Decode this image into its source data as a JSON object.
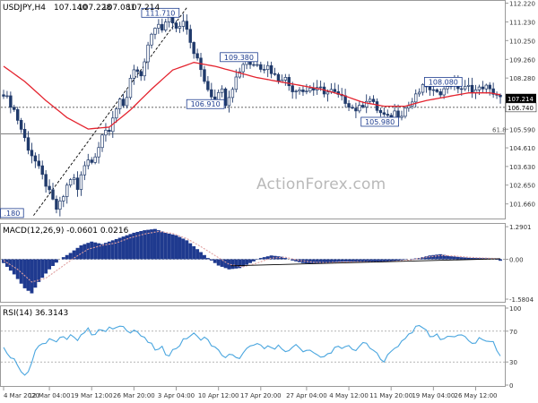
{
  "chart_data": [
    {
      "type": "candlestick",
      "title": "USDJPY,H4",
      "header_values": [
        "107.140",
        "107.228",
        "107.081",
        "107.214"
      ],
      "ylim": [
        100.94,
        112.29
      ],
      "y_ticks": [
        "112.220",
        "111.230",
        "110.250",
        "109.260",
        "108.280",
        "107.214",
        "106.740",
        "105.590",
        "104.610",
        "103.630",
        "102.650",
        "101.660"
      ],
      "current_price": 107.214,
      "current_price_label": "107.214",
      "support_level": 106.74,
      "support_level_label": "106.740",
      "fib_level": 105.35,
      "fib_label": "61.8",
      "close_path": [
        [
          0,
          107.5
        ],
        [
          3,
          106.6
        ],
        [
          5,
          105.6
        ],
        [
          7,
          104.6
        ],
        [
          9,
          103.9
        ],
        [
          10.5,
          103.3
        ],
        [
          12,
          102.7
        ],
        [
          13.5,
          102.0
        ],
        [
          15,
          101.4
        ],
        [
          16.5,
          101.8
        ],
        [
          18,
          102.6
        ],
        [
          19.5,
          103.2
        ],
        [
          21,
          102.4
        ],
        [
          22.5,
          103.5
        ],
        [
          24,
          104.1
        ],
        [
          25.5,
          103.8
        ],
        [
          27,
          104.8
        ],
        [
          28.5,
          105.7
        ],
        [
          30,
          105.3
        ],
        [
          31.5,
          106.5
        ],
        [
          33,
          107.2
        ],
        [
          34.5,
          106.8
        ],
        [
          36,
          108.1
        ],
        [
          37.5,
          108.8
        ],
        [
          39,
          108.3
        ],
        [
          40.5,
          109.5
        ],
        [
          42,
          110.6
        ],
        [
          43.5,
          111.2
        ],
        [
          45,
          110.7
        ],
        [
          46.5,
          111.6
        ],
        [
          48,
          111.3
        ],
        [
          49.5,
          110.9
        ],
        [
          51,
          111.4
        ],
        [
          52.5,
          110.4
        ],
        [
          54,
          109.6
        ],
        [
          55.5,
          109.0
        ],
        [
          57,
          108.2
        ],
        [
          58.5,
          107.5
        ],
        [
          60,
          107.2
        ],
        [
          61.5,
          107.9
        ],
        [
          63,
          107.0
        ],
        [
          64.5,
          107.6
        ],
        [
          66,
          108.3
        ],
        [
          67.5,
          108.9
        ],
        [
          69,
          109.3
        ],
        [
          70.5,
          108.9
        ],
        [
          72,
          109.1
        ],
        [
          73.5,
          108.8
        ],
        [
          75,
          108.9
        ],
        [
          76.5,
          108.5
        ],
        [
          78,
          108.2
        ],
        [
          79.5,
          108.4
        ],
        [
          81,
          107.9
        ],
        [
          82.5,
          107.6
        ],
        [
          84,
          107.8
        ],
        [
          85.5,
          107.5
        ],
        [
          87,
          107.8
        ],
        [
          88.5,
          107.6
        ],
        [
          90,
          107.7
        ],
        [
          91.5,
          107.5
        ],
        [
          93,
          107.6
        ],
        [
          94.5,
          107.4
        ],
        [
          96,
          107.2
        ],
        [
          97.5,
          107.0
        ],
        [
          99,
          106.7
        ],
        [
          100.5,
          106.6
        ],
        [
          102,
          106.9
        ],
        [
          103.5,
          107.3
        ],
        [
          105,
          106.9
        ],
        [
          106.5,
          106.5
        ],
        [
          108,
          106.3
        ],
        [
          109.5,
          106.1
        ],
        [
          111,
          106.5
        ],
        [
          112.5,
          106.3
        ],
        [
          114,
          106.7
        ],
        [
          115.5,
          106.9
        ],
        [
          117,
          107.3
        ],
        [
          118.5,
          107.7
        ],
        [
          120,
          107.9
        ],
        [
          121.5,
          107.4
        ],
        [
          123,
          107.7
        ],
        [
          124.5,
          107.5
        ],
        [
          126,
          107.9
        ],
        [
          127.5,
          108.0
        ],
        [
          129,
          107.8
        ],
        [
          130.5,
          107.7
        ],
        [
          132,
          107.8
        ],
        [
          133.5,
          107.6
        ],
        [
          135,
          107.7
        ],
        [
          136.5,
          107.9
        ],
        [
          138,
          107.6
        ],
        [
          139.5,
          107.5
        ],
        [
          141,
          107.2
        ]
      ],
      "ma_path": [
        [
          0,
          108.9
        ],
        [
          6,
          108.1
        ],
        [
          12,
          107.1
        ],
        [
          18,
          106.2
        ],
        [
          24,
          105.6
        ],
        [
          30,
          105.7
        ],
        [
          36,
          106.6
        ],
        [
          42,
          107.7
        ],
        [
          48,
          108.7
        ],
        [
          54,
          109.1
        ],
        [
          60,
          108.9
        ],
        [
          66,
          108.6
        ],
        [
          72,
          108.3
        ],
        [
          78,
          108.1
        ],
        [
          84,
          107.9
        ],
        [
          90,
          107.7
        ],
        [
          96,
          107.4
        ],
        [
          102,
          107.0
        ],
        [
          108,
          106.8
        ],
        [
          114,
          106.8
        ],
        [
          120,
          107.1
        ],
        [
          126,
          107.3
        ],
        [
          132,
          107.5
        ],
        [
          138,
          107.5
        ],
        [
          141,
          107.4
        ]
      ],
      "trendline": [
        [
          8.5,
          101.05
        ],
        [
          52,
          111.98
        ]
      ],
      "annotations": [
        {
          "text": "111.710",
          "x": 44.5,
          "y": 111.71
        },
        {
          "text": "109.380",
          "x": 66.8,
          "y": 109.38
        },
        {
          "text": "106.910",
          "x": 57.3,
          "y": 106.91
        },
        {
          "text": "108.080",
          "x": 124.8,
          "y": 108.08
        },
        {
          "text": "105.980",
          "x": 106.8,
          "y": 105.98
        },
        {
          "text": ".180",
          "x": 2.4,
          "y": 101.18
        }
      ],
      "x_ticks": [
        {
          "label": "4 Mar 2020",
          "i": 0
        },
        {
          "label": "12 Mar 04:00",
          "i": 13
        },
        {
          "label": "19 Mar 12:00",
          "i": 25
        },
        {
          "label": "26 Mar 20:00",
          "i": 37
        },
        {
          "label": "3 Apr 04:00",
          "i": 49
        },
        {
          "label": "10 Apr 12:00",
          "i": 61
        },
        {
          "label": "17 Apr 20:00",
          "i": 73
        },
        {
          "label": "27 Apr 04:00",
          "i": 86
        },
        {
          "label": "4 May 12:00",
          "i": 98
        },
        {
          "label": "11 May 20:00",
          "i": 110
        },
        {
          "label": "19 May 04:00",
          "i": 122
        },
        {
          "label": "26 May 12:00",
          "i": 134
        }
      ],
      "x_count": 142
    },
    {
      "type": "histogram",
      "title": "MACD(12,26,9) -0.0601 0.0216",
      "ylim": [
        -1.65,
        1.33
      ],
      "y_ticks": [
        "1.2901",
        "0.00",
        "-1.5804"
      ],
      "macd_path": [
        [
          0,
          -0.15
        ],
        [
          3,
          -0.6
        ],
        [
          6,
          -1.15
        ],
        [
          8,
          -1.35
        ],
        [
          10,
          -0.9
        ],
        [
          13,
          -0.4
        ],
        [
          16,
          0.0
        ],
        [
          19,
          0.25
        ],
        [
          22,
          0.55
        ],
        [
          25,
          0.7
        ],
        [
          28,
          0.6
        ],
        [
          31,
          0.75
        ],
        [
          34,
          0.9
        ],
        [
          37,
          1.05
        ],
        [
          40,
          1.15
        ],
        [
          43,
          1.2
        ],
        [
          46,
          1.05
        ],
        [
          49,
          0.95
        ],
        [
          52,
          0.75
        ],
        [
          55,
          0.4
        ],
        [
          58,
          0.05
        ],
        [
          61,
          -0.25
        ],
        [
          64,
          -0.4
        ],
        [
          67,
          -0.35
        ],
        [
          70,
          -0.15
        ],
        [
          73,
          0.05
        ],
        [
          76,
          0.15
        ],
        [
          79,
          0.1
        ],
        [
          82,
          -0.05
        ],
        [
          85,
          -0.15
        ],
        [
          88,
          -0.18
        ],
        [
          91,
          -0.15
        ],
        [
          94,
          -0.12
        ],
        [
          97,
          -0.1
        ],
        [
          100,
          -0.1
        ],
        [
          103,
          -0.1
        ],
        [
          106,
          -0.12
        ],
        [
          109,
          -0.1
        ],
        [
          112,
          -0.05
        ],
        [
          115,
          0.0
        ],
        [
          118,
          0.05
        ],
        [
          121,
          0.15
        ],
        [
          124,
          0.2
        ],
        [
          127,
          0.12
        ],
        [
          130,
          0.08
        ],
        [
          133,
          0.05
        ],
        [
          136,
          0.05
        ],
        [
          139,
          0.03
        ],
        [
          141,
          -0.06
        ]
      ],
      "signal_path": [
        [
          0,
          -0.05
        ],
        [
          4,
          -0.4
        ],
        [
          8,
          -0.9
        ],
        [
          12,
          -0.75
        ],
        [
          16,
          -0.35
        ],
        [
          20,
          0.05
        ],
        [
          24,
          0.4
        ],
        [
          28,
          0.55
        ],
        [
          32,
          0.65
        ],
        [
          36,
          0.85
        ],
        [
          40,
          1.0
        ],
        [
          44,
          1.1
        ],
        [
          48,
          1.02
        ],
        [
          52,
          0.82
        ],
        [
          56,
          0.5
        ],
        [
          60,
          0.15
        ],
        [
          64,
          -0.2
        ],
        [
          68,
          -0.3
        ],
        [
          72,
          -0.15
        ],
        [
          76,
          0.05
        ],
        [
          80,
          0.08
        ],
        [
          84,
          -0.05
        ],
        [
          88,
          -0.12
        ],
        [
          92,
          -0.13
        ],
        [
          96,
          -0.11
        ],
        [
          100,
          -0.1
        ],
        [
          104,
          -0.1
        ],
        [
          108,
          -0.1
        ],
        [
          112,
          -0.07
        ],
        [
          116,
          -0.02
        ],
        [
          120,
          0.08
        ],
        [
          124,
          0.15
        ],
        [
          128,
          0.13
        ],
        [
          132,
          0.08
        ],
        [
          136,
          0.05
        ],
        [
          141,
          0.02
        ]
      ],
      "trendline": [
        [
          64.5,
          -0.26
        ],
        [
          141,
          0.02
        ]
      ]
    },
    {
      "type": "line",
      "title": "RSI(14) 36.3143",
      "ylim": [
        0,
        100
      ],
      "y_ticks": [
        "100",
        "70",
        "30",
        "0"
      ],
      "levels": [
        70,
        30
      ],
      "rsi_path": [
        [
          0,
          48
        ],
        [
          1.5,
          40
        ],
        [
          3,
          33
        ],
        [
          4.5,
          22
        ],
        [
          6,
          14
        ],
        [
          7.5,
          22
        ],
        [
          9,
          45
        ],
        [
          10.5,
          55
        ],
        [
          12,
          52
        ],
        [
          13.5,
          62
        ],
        [
          15,
          56
        ],
        [
          16.5,
          63
        ],
        [
          18,
          58
        ],
        [
          19.5,
          66
        ],
        [
          21,
          60
        ],
        [
          22.5,
          68
        ],
        [
          24,
          72
        ],
        [
          25.5,
          65
        ],
        [
          27,
          72
        ],
        [
          28.5,
          68
        ],
        [
          30,
          75
        ],
        [
          31.5,
          70
        ],
        [
          33,
          78
        ],
        [
          34.5,
          74
        ],
        [
          36,
          70
        ],
        [
          37.5,
          72
        ],
        [
          39,
          64
        ],
        [
          40.5,
          58
        ],
        [
          42,
          52
        ],
        [
          43.5,
          44
        ],
        [
          45,
          48
        ],
        [
          46.5,
          38
        ],
        [
          48,
          45
        ],
        [
          49.5,
          50
        ],
        [
          51,
          58
        ],
        [
          52.5,
          63
        ],
        [
          54,
          66
        ],
        [
          55.5,
          60
        ],
        [
          57,
          62
        ],
        [
          58.5,
          55
        ],
        [
          60,
          48
        ],
        [
          61.5,
          42
        ],
        [
          63,
          36
        ],
        [
          64.5,
          40
        ],
        [
          66,
          34
        ],
        [
          67.5,
          38
        ],
        [
          69,
          46
        ],
        [
          70.5,
          50
        ],
        [
          72,
          54
        ],
        [
          73.5,
          48
        ],
        [
          75,
          53
        ],
        [
          76.5,
          45
        ],
        [
          78,
          50
        ],
        [
          79.5,
          42
        ],
        [
          81,
          46
        ],
        [
          82.5,
          52
        ],
        [
          84,
          48
        ],
        [
          85.5,
          44
        ],
        [
          87,
          47
        ],
        [
          88.5,
          40
        ],
        [
          90,
          35
        ],
        [
          91.5,
          38
        ],
        [
          93,
          44
        ],
        [
          94.5,
          50
        ],
        [
          96,
          46
        ],
        [
          97.5,
          52
        ],
        [
          99,
          48
        ],
        [
          100.5,
          44
        ],
        [
          102,
          56
        ],
        [
          103.5,
          50
        ],
        [
          105,
          44
        ],
        [
          106.5,
          38
        ],
        [
          108,
          32
        ],
        [
          109.5,
          40
        ],
        [
          111,
          48
        ],
        [
          112.5,
          54
        ],
        [
          114,
          62
        ],
        [
          115.5,
          68
        ],
        [
          117,
          74
        ],
        [
          118.5,
          78
        ],
        [
          120,
          70
        ],
        [
          121.5,
          62
        ],
        [
          123,
          66
        ],
        [
          124.5,
          58
        ],
        [
          126,
          64
        ],
        [
          127.5,
          60
        ],
        [
          129,
          66
        ],
        [
          130.5,
          62
        ],
        [
          132,
          58
        ],
        [
          133.5,
          54
        ],
        [
          135,
          60
        ],
        [
          136.5,
          56
        ],
        [
          138,
          58
        ],
        [
          139.5,
          52
        ],
        [
          141,
          36
        ]
      ]
    }
  ],
  "watermark": "ActionForex.com",
  "colors": {
    "background": "#ffffff",
    "candle_up": "#203a6b",
    "candle_down": "#203a6b",
    "moving_average": "#e4242f",
    "macd_histogram": "#1f3a8f",
    "macd_signal": "#e0a0a0",
    "rsi_line": "#4aa6df",
    "trendline": "#000000",
    "grid": "#e6e6e6",
    "axis": "#9a9a9a"
  }
}
